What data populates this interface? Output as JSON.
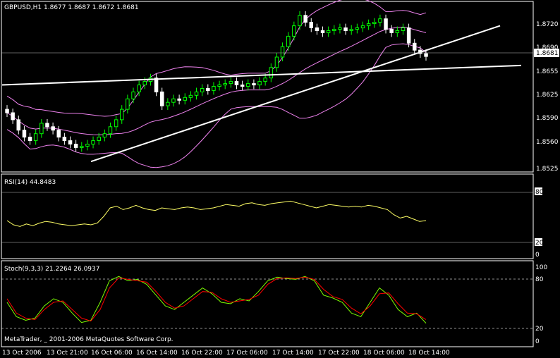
{
  "main_panel": {
    "title": "GBPUSD,H1  1.8677 1.8687 1.8672 1.8681",
    "price_labels": [
      "1.8720",
      "1.8690",
      "1.8655",
      "1.8625",
      "1.8590",
      "1.8560",
      "1.8525"
    ],
    "current_price": "1.8681"
  },
  "rsi_panel": {
    "title": "RSI(14) 44.8483",
    "levels": [
      "80",
      "20",
      "0"
    ],
    "level_values": [
      80,
      20
    ]
  },
  "stoch_panel": {
    "title": "Stoch(9,3,3) 21.2264 26.0937",
    "levels": [
      "100",
      "80",
      "20",
      "0"
    ],
    "level_values": [
      80,
      20
    ]
  },
  "footer": {
    "copyright": "MetaTrader, _ 2001-2006 MetaQuotes Software Corp."
  },
  "time_labels": [
    "13 Oct 2006",
    "13 Oct 21:00",
    "16 Oct 06:00",
    "16 Oct 14:00",
    "16 Oct 22:00",
    "17 Oct 06:00",
    "17 Oct 14:00",
    "17 Oct 22:00",
    "18 Oct 06:00",
    "18 Oct 14:00"
  ],
  "colors": {
    "background": "#000000",
    "grid": "#ffffff",
    "up_candle": "#00ff00",
    "down_candle": "#ffffff",
    "bollinger": "#ee82ee",
    "rsi_line": "#ffff66",
    "stoch_main": "#7cfc00",
    "stoch_signal": "#ff0000",
    "trendline": "#ffffff"
  },
  "chart_data": [
    {
      "type": "candlestick",
      "symbol": "GBPUSD",
      "timeframe": "H1",
      "title": "GBPUSD,H1  1.8677 1.8687 1.8672 1.8681",
      "ylim": [
        1.8515,
        1.876
      ],
      "y_ticks": [
        1.872,
        1.869,
        1.8655,
        1.8625,
        1.859,
        1.856,
        1.8525
      ],
      "current_price": 1.8681,
      "closes": [
        1.86,
        1.859,
        1.8575,
        1.8565,
        1.856,
        1.857,
        1.8585,
        1.858,
        1.8575,
        1.8565,
        1.856,
        1.8555,
        1.855,
        1.8552,
        1.8555,
        1.856,
        1.8565,
        1.857,
        1.858,
        1.859,
        1.8605,
        1.862,
        1.863,
        1.864,
        1.8645,
        1.865,
        1.863,
        1.861,
        1.8615,
        1.862,
        1.8618,
        1.8622,
        1.8625,
        1.863,
        1.8635,
        1.8632,
        1.8638,
        1.864,
        1.8642,
        1.8645,
        1.864,
        1.8638,
        1.8642,
        1.864,
        1.8645,
        1.865,
        1.8665,
        1.868,
        1.8695,
        1.871,
        1.8725,
        1.874,
        1.873,
        1.8722,
        1.8718,
        1.8715,
        1.8718,
        1.872,
        1.8722,
        1.8718,
        1.872,
        1.8722,
        1.8725,
        1.8728,
        1.873,
        1.8735,
        1.872,
        1.8715,
        1.8718,
        1.8722,
        1.87,
        1.869,
        1.8685,
        1.8681
      ],
      "bollinger_bands": [
        "upper",
        "middle",
        "lower"
      ],
      "trendlines": [
        {
          "from": [
            "13 Oct 2006",
            1.864
          ],
          "to": [
            "18 Oct 14:00",
            1.8668
          ]
        },
        {
          "from": [
            "16 Oct 06:00",
            1.853
          ],
          "to": [
            "18 Oct 14:00",
            1.8725
          ]
        }
      ]
    },
    {
      "type": "line",
      "title": "RSI(14) 44.8483",
      "ylim": [
        0,
        100
      ],
      "levels": [
        80,
        20
      ],
      "last_value": 44.8483,
      "values": [
        45,
        40,
        38,
        41,
        39,
        42,
        44,
        43,
        41,
        40,
        39,
        40,
        41,
        40,
        42,
        50,
        60,
        62,
        58,
        60,
        63,
        60,
        58,
        57,
        60,
        59,
        58,
        60,
        61,
        60,
        58,
        59,
        60,
        62,
        64,
        63,
        62,
        65,
        66,
        64,
        63,
        65,
        66,
        67,
        68,
        66,
        64,
        62,
        60,
        62,
        64,
        63,
        62,
        61,
        62,
        61,
        63,
        62,
        60,
        58,
        52,
        48,
        50,
        47,
        44,
        45
      ]
    },
    {
      "type": "line",
      "title": "Stoch(9,3,3) 21.2264 26.0937",
      "ylim": [
        0,
        100
      ],
      "levels": [
        80,
        20
      ],
      "series": [
        {
          "name": "21.2264",
          "values": [
            50,
            30,
            25,
            28,
            45,
            55,
            50,
            35,
            22,
            25,
            50,
            80,
            86,
            80,
            82,
            75,
            60,
            45,
            40,
            50,
            60,
            70,
            62,
            50,
            48,
            55,
            52,
            65,
            80,
            85,
            83,
            82,
            86,
            80,
            60,
            56,
            50,
            35,
            30,
            50,
            70,
            60,
            40,
            30,
            35,
            21
          ]
        },
        {
          "name": "26.0937",
          "values": [
            55,
            35,
            28,
            26,
            40,
            50,
            52,
            40,
            28,
            24,
            40,
            70,
            84,
            82,
            80,
            78,
            65,
            50,
            42,
            45,
            55,
            65,
            64,
            55,
            50,
            52,
            54,
            60,
            75,
            83,
            84,
            83,
            85,
            82,
            68,
            58,
            54,
            42,
            34,
            45,
            62,
            63,
            48,
            35,
            34,
            26
          ]
        }
      ]
    }
  ]
}
